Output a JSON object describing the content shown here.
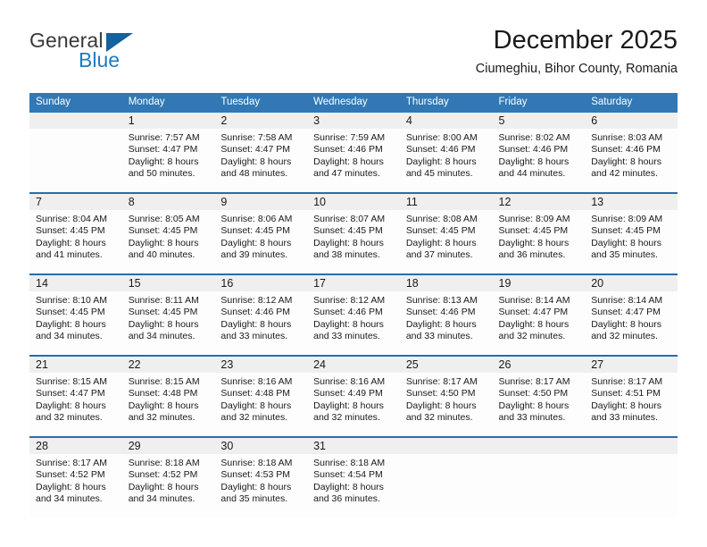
{
  "logo": {
    "word_top": "General",
    "word_bottom": "Blue",
    "triangle_icon": "blue-triangle-icon",
    "color_top": "#3a3a3a",
    "color_bottom": "#1f7bc1"
  },
  "header": {
    "title": "December 2025",
    "subtitle": "Ciumeghiu, Bihor County, Romania"
  },
  "theme": {
    "header_bg": "#3178b4",
    "header_text": "#ffffff",
    "row_divider": "#2b6ca8",
    "daynum_band_bg": "#efefef",
    "cell_bg": "#fdfdfd",
    "body_text": "#1a1a1a"
  },
  "weekday_headers": [
    "Sunday",
    "Monday",
    "Tuesday",
    "Wednesday",
    "Thursday",
    "Friday",
    "Saturday"
  ],
  "weeks": [
    [
      {
        "day": "",
        "empty": true,
        "lines": []
      },
      {
        "day": "1",
        "empty": false,
        "lines": [
          "Sunrise: 7:57 AM",
          "Sunset: 4:47 PM",
          "Daylight: 8 hours",
          "and 50 minutes."
        ]
      },
      {
        "day": "2",
        "empty": false,
        "lines": [
          "Sunrise: 7:58 AM",
          "Sunset: 4:47 PM",
          "Daylight: 8 hours",
          "and 48 minutes."
        ]
      },
      {
        "day": "3",
        "empty": false,
        "lines": [
          "Sunrise: 7:59 AM",
          "Sunset: 4:46 PM",
          "Daylight: 8 hours",
          "and 47 minutes."
        ]
      },
      {
        "day": "4",
        "empty": false,
        "lines": [
          "Sunrise: 8:00 AM",
          "Sunset: 4:46 PM",
          "Daylight: 8 hours",
          "and 45 minutes."
        ]
      },
      {
        "day": "5",
        "empty": false,
        "lines": [
          "Sunrise: 8:02 AM",
          "Sunset: 4:46 PM",
          "Daylight: 8 hours",
          "and 44 minutes."
        ]
      },
      {
        "day": "6",
        "empty": false,
        "lines": [
          "Sunrise: 8:03 AM",
          "Sunset: 4:46 PM",
          "Daylight: 8 hours",
          "and 42 minutes."
        ]
      }
    ],
    [
      {
        "day": "7",
        "empty": false,
        "lines": [
          "Sunrise: 8:04 AM",
          "Sunset: 4:45 PM",
          "Daylight: 8 hours",
          "and 41 minutes."
        ]
      },
      {
        "day": "8",
        "empty": false,
        "lines": [
          "Sunrise: 8:05 AM",
          "Sunset: 4:45 PM",
          "Daylight: 8 hours",
          "and 40 minutes."
        ]
      },
      {
        "day": "9",
        "empty": false,
        "lines": [
          "Sunrise: 8:06 AM",
          "Sunset: 4:45 PM",
          "Daylight: 8 hours",
          "and 39 minutes."
        ]
      },
      {
        "day": "10",
        "empty": false,
        "lines": [
          "Sunrise: 8:07 AM",
          "Sunset: 4:45 PM",
          "Daylight: 8 hours",
          "and 38 minutes."
        ]
      },
      {
        "day": "11",
        "empty": false,
        "lines": [
          "Sunrise: 8:08 AM",
          "Sunset: 4:45 PM",
          "Daylight: 8 hours",
          "and 37 minutes."
        ]
      },
      {
        "day": "12",
        "empty": false,
        "lines": [
          "Sunrise: 8:09 AM",
          "Sunset: 4:45 PM",
          "Daylight: 8 hours",
          "and 36 minutes."
        ]
      },
      {
        "day": "13",
        "empty": false,
        "lines": [
          "Sunrise: 8:09 AM",
          "Sunset: 4:45 PM",
          "Daylight: 8 hours",
          "and 35 minutes."
        ]
      }
    ],
    [
      {
        "day": "14",
        "empty": false,
        "lines": [
          "Sunrise: 8:10 AM",
          "Sunset: 4:45 PM",
          "Daylight: 8 hours",
          "and 34 minutes."
        ]
      },
      {
        "day": "15",
        "empty": false,
        "lines": [
          "Sunrise: 8:11 AM",
          "Sunset: 4:45 PM",
          "Daylight: 8 hours",
          "and 34 minutes."
        ]
      },
      {
        "day": "16",
        "empty": false,
        "lines": [
          "Sunrise: 8:12 AM",
          "Sunset: 4:46 PM",
          "Daylight: 8 hours",
          "and 33 minutes."
        ]
      },
      {
        "day": "17",
        "empty": false,
        "lines": [
          "Sunrise: 8:12 AM",
          "Sunset: 4:46 PM",
          "Daylight: 8 hours",
          "and 33 minutes."
        ]
      },
      {
        "day": "18",
        "empty": false,
        "lines": [
          "Sunrise: 8:13 AM",
          "Sunset: 4:46 PM",
          "Daylight: 8 hours",
          "and 33 minutes."
        ]
      },
      {
        "day": "19",
        "empty": false,
        "lines": [
          "Sunrise: 8:14 AM",
          "Sunset: 4:47 PM",
          "Daylight: 8 hours",
          "and 32 minutes."
        ]
      },
      {
        "day": "20",
        "empty": false,
        "lines": [
          "Sunrise: 8:14 AM",
          "Sunset: 4:47 PM",
          "Daylight: 8 hours",
          "and 32 minutes."
        ]
      }
    ],
    [
      {
        "day": "21",
        "empty": false,
        "lines": [
          "Sunrise: 8:15 AM",
          "Sunset: 4:47 PM",
          "Daylight: 8 hours",
          "and 32 minutes."
        ]
      },
      {
        "day": "22",
        "empty": false,
        "lines": [
          "Sunrise: 8:15 AM",
          "Sunset: 4:48 PM",
          "Daylight: 8 hours",
          "and 32 minutes."
        ]
      },
      {
        "day": "23",
        "empty": false,
        "lines": [
          "Sunrise: 8:16 AM",
          "Sunset: 4:48 PM",
          "Daylight: 8 hours",
          "and 32 minutes."
        ]
      },
      {
        "day": "24",
        "empty": false,
        "lines": [
          "Sunrise: 8:16 AM",
          "Sunset: 4:49 PM",
          "Daylight: 8 hours",
          "and 32 minutes."
        ]
      },
      {
        "day": "25",
        "empty": false,
        "lines": [
          "Sunrise: 8:17 AM",
          "Sunset: 4:50 PM",
          "Daylight: 8 hours",
          "and 32 minutes."
        ]
      },
      {
        "day": "26",
        "empty": false,
        "lines": [
          "Sunrise: 8:17 AM",
          "Sunset: 4:50 PM",
          "Daylight: 8 hours",
          "and 33 minutes."
        ]
      },
      {
        "day": "27",
        "empty": false,
        "lines": [
          "Sunrise: 8:17 AM",
          "Sunset: 4:51 PM",
          "Daylight: 8 hours",
          "and 33 minutes."
        ]
      }
    ],
    [
      {
        "day": "28",
        "empty": false,
        "lines": [
          "Sunrise: 8:17 AM",
          "Sunset: 4:52 PM",
          "Daylight: 8 hours",
          "and 34 minutes."
        ]
      },
      {
        "day": "29",
        "empty": false,
        "lines": [
          "Sunrise: 8:18 AM",
          "Sunset: 4:52 PM",
          "Daylight: 8 hours",
          "and 34 minutes."
        ]
      },
      {
        "day": "30",
        "empty": false,
        "lines": [
          "Sunrise: 8:18 AM",
          "Sunset: 4:53 PM",
          "Daylight: 8 hours",
          "and 35 minutes."
        ]
      },
      {
        "day": "31",
        "empty": false,
        "lines": [
          "Sunrise: 8:18 AM",
          "Sunset: 4:54 PM",
          "Daylight: 8 hours",
          "and 36 minutes."
        ]
      },
      {
        "day": "",
        "empty": true,
        "lines": []
      },
      {
        "day": "",
        "empty": true,
        "lines": []
      },
      {
        "day": "",
        "empty": true,
        "lines": []
      }
    ]
  ]
}
